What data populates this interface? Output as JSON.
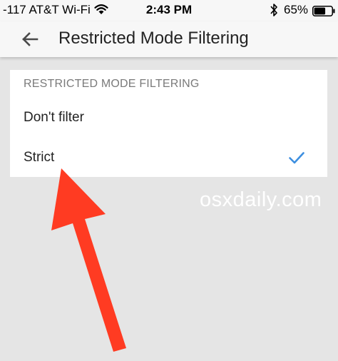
{
  "status_bar": {
    "carrier": "-117 AT&T Wi-Fi",
    "time": "2:43 PM",
    "battery": "65%",
    "icons": [
      "wifi-icon",
      "bluetooth-icon",
      "battery-icon"
    ]
  },
  "app_bar": {
    "back_icon": "arrow-back-icon",
    "title": "Restricted Mode Filtering"
  },
  "filtering": {
    "section_header": "RESTRICTED MODE FILTERING",
    "options": [
      {
        "label": "Don't filter",
        "selected": false
      },
      {
        "label": "Strict",
        "selected": true
      }
    ],
    "check_icon": "checkmark-icon"
  },
  "overlay": {
    "watermark": "osxdaily.com",
    "annotation_icon": "red-arrow-icon"
  },
  "colors": {
    "background": "#e5e5e5",
    "bar_background": "#f7f7f7",
    "card_background": "#ffffff",
    "checkmark": "#3d8fe0",
    "arrow": "#ff3b22",
    "header_text": "#7a7a7a"
  }
}
